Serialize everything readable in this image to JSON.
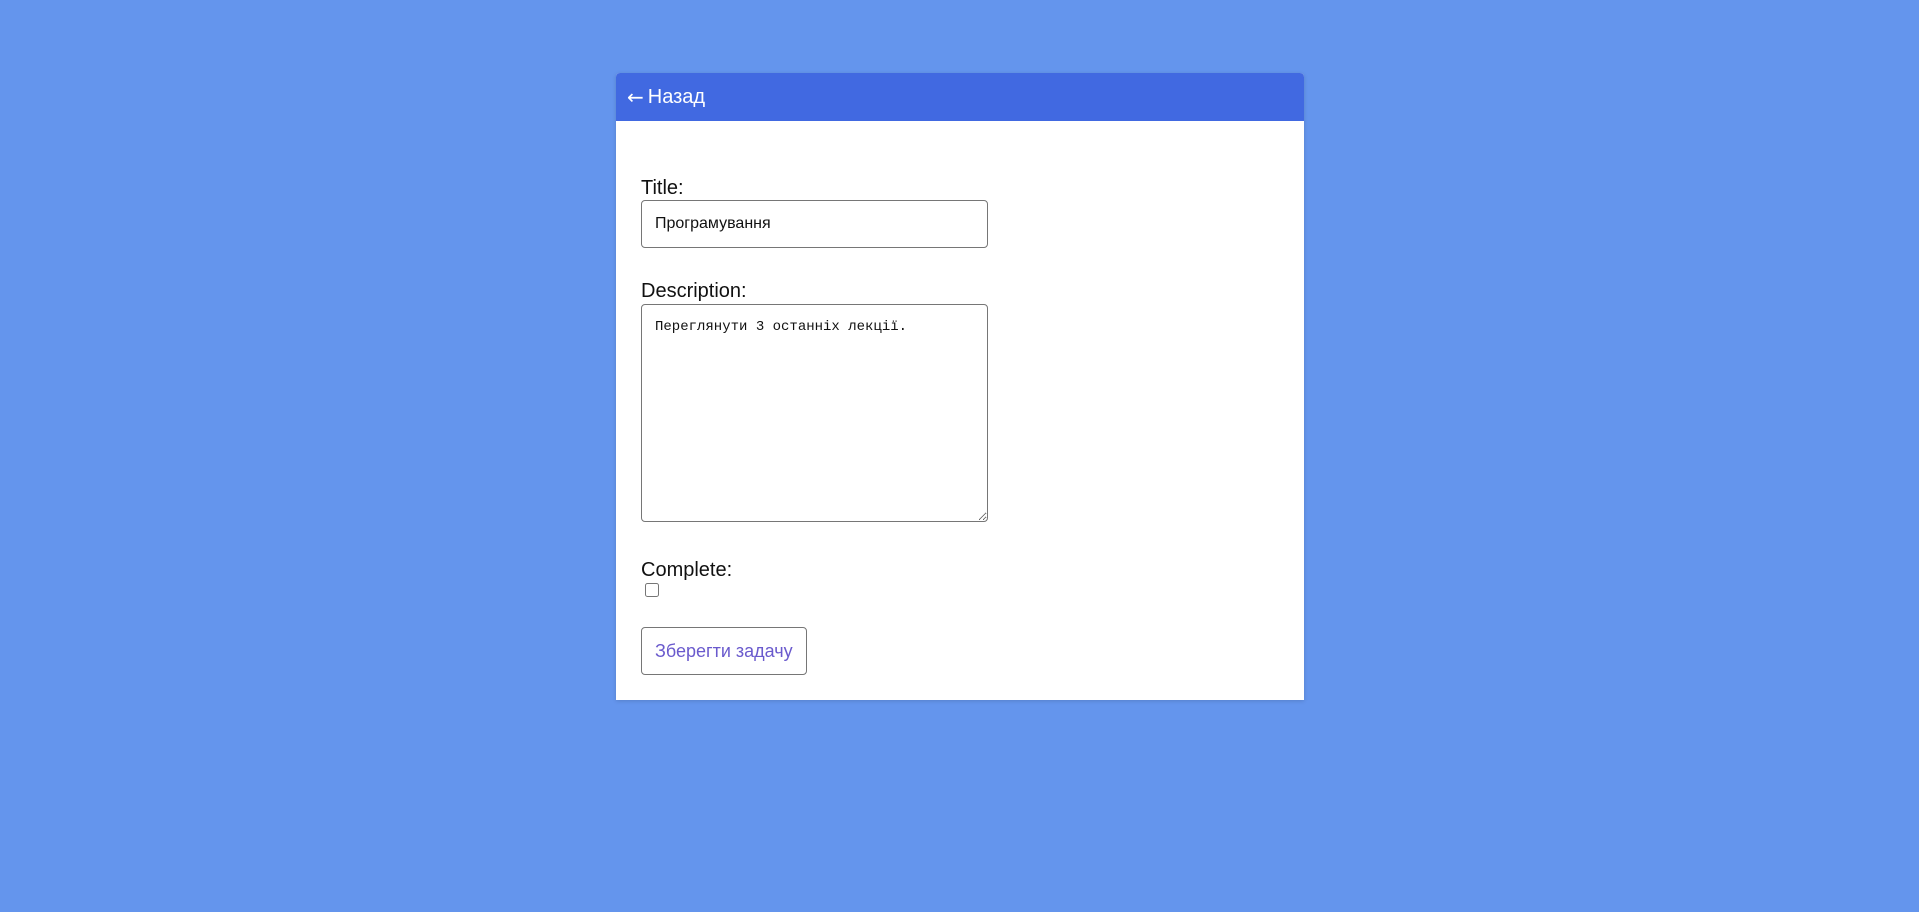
{
  "header": {
    "back_arrow": "←",
    "back_label": "Назад",
    "background_color": "#4169E1"
  },
  "page": {
    "background_color": "#6495ED"
  },
  "form": {
    "title_label": "Title:",
    "title_value": "Програмування",
    "description_label": "Description:",
    "description_value": "Переглянути 3 останніх лекції.",
    "complete_label": "Complete:",
    "complete_checked": false,
    "save_label": "Зберегти задачу"
  }
}
